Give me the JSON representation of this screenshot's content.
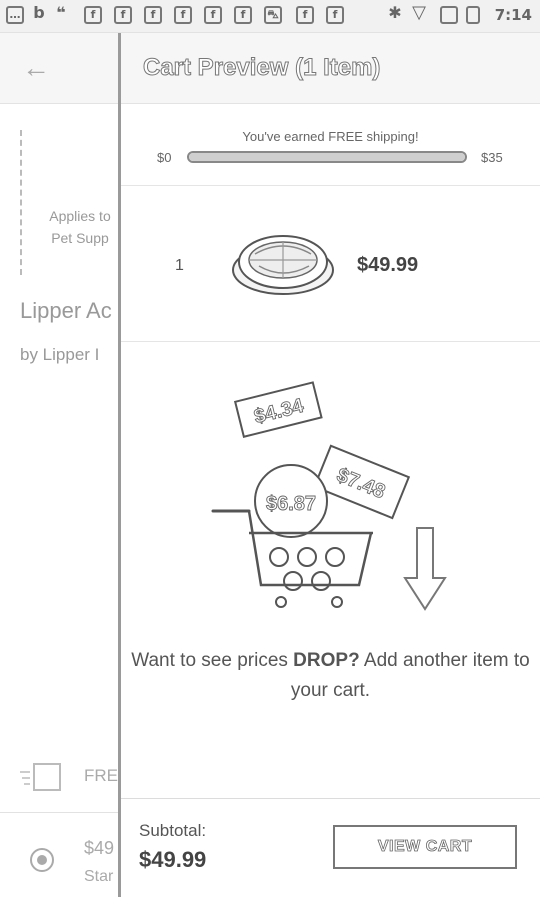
{
  "status_bar": {
    "time": "7:14"
  },
  "background_page": {
    "promo_line1": "Applies to",
    "promo_line2": "Pet Supp",
    "product_title": "Lipper Ac",
    "product_by": "by Lipper I",
    "free_label": "FRE",
    "price": "$49",
    "standard": "Star"
  },
  "cart_preview": {
    "title": "Cart Preview (1 Item)",
    "shipping": {
      "message": "You've earned FREE shipping!",
      "min_label": "$0",
      "max_label": "$35",
      "progress": 1.0
    },
    "item": {
      "quantity": "1",
      "price": "$49.99"
    },
    "illustration": {
      "tag1": "$4.34",
      "tag2": "$7.48",
      "tag3": "$6.87"
    },
    "drop_message": {
      "part1": "Want to see prices ",
      "bold": "DROP?",
      "part2": "  Add another item to your cart."
    },
    "footer": {
      "subtotal_label": "Subtotal:",
      "subtotal_value": "$49.99",
      "view_cart_label": "VIEW CART"
    }
  }
}
